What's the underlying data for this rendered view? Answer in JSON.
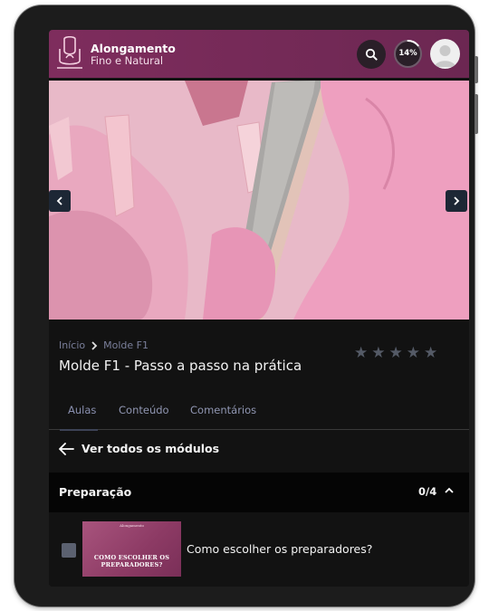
{
  "app": {
    "brand_line1": "Alongamento",
    "brand_line2": "Fino e Natural",
    "progress_label": "14%",
    "progress_fraction": 0.14,
    "accent_color": "#7e2d5d"
  },
  "icons": {
    "logo": "nail-logo-icon",
    "search": "search-icon",
    "avatar": "user-avatar-icon",
    "prev": "chevron-left-icon",
    "next": "chevron-right-icon",
    "back": "arrow-left-icon",
    "collapse": "chevron-up-icon",
    "breadcrumb_sep": "chevron-right-icon",
    "star": "star-icon"
  },
  "lesson": {
    "breadcrumb": [
      "Início",
      "Molde F1"
    ],
    "title": "Molde F1 - Passo a passo na prática",
    "rating": 0,
    "max_rating": 5
  },
  "tabs": [
    {
      "label": "Aulas",
      "active": true
    },
    {
      "label": "Conteúdo",
      "active": false
    },
    {
      "label": "Comentários",
      "active": false
    }
  ],
  "back_link": "Ver todos os módulos",
  "module": {
    "title": "Preparação",
    "progress": "0/4",
    "expanded": true
  },
  "lessons": [
    {
      "name": "Como escolher os preparadores?",
      "thumbnail_caption": "COMO ESCOLHER OS PREPARADORES?",
      "completed": false
    }
  ]
}
